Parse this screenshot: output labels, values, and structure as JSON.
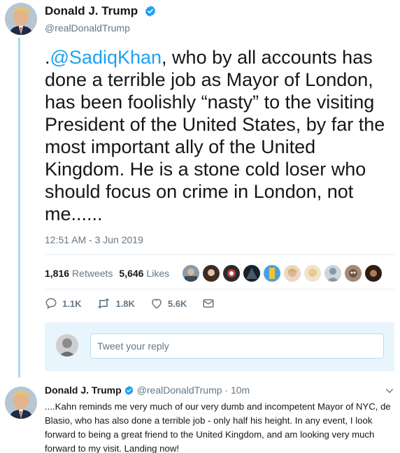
{
  "main_tweet": {
    "display_name": "Donald J. Trump",
    "handle": "@realDonaldTrump",
    "text_prefix": ".",
    "mention": "@SadiqKhan",
    "text_body": ", who by all accounts has done a terrible job as Mayor of London, has been foolishly “nasty” to the visiting President of the United States, by far the most important ally of the United Kingdom. He is a stone cold loser who should focus on crime in London, not me......",
    "timestamp": "12:51 AM - 3 Jun 2019",
    "retweets_count": "1,816",
    "retweets_label": "Retweets",
    "likes_count": "5,646",
    "likes_label": "Likes",
    "actions": {
      "reply_count": "1.1K",
      "retweet_count": "1.8K",
      "like_count": "5.6K"
    }
  },
  "reply_box": {
    "placeholder": "Tweet your reply"
  },
  "second_tweet": {
    "display_name": "Donald J. Trump",
    "handle_time": "@realDonaldTrump · 10m",
    "text": "....Kahn reminds me very much of our very dumb and incompetent Mayor of NYC, de Blasio, who has also done a terrible job - only half his height. In any event, I look forward to being a great friend to the United Kingdom, and am looking very much forward to my visit. Landing now!"
  },
  "colors": {
    "accent": "#1da1f2",
    "secondary_text": "#657786",
    "thread_line": "#a6dcf6",
    "reply_box_bg": "#e8f5fd"
  },
  "icons": [
    "verified-badge-icon",
    "reply-icon",
    "retweet-icon",
    "like-icon",
    "direct-message-icon",
    "chevron-down-icon"
  ]
}
